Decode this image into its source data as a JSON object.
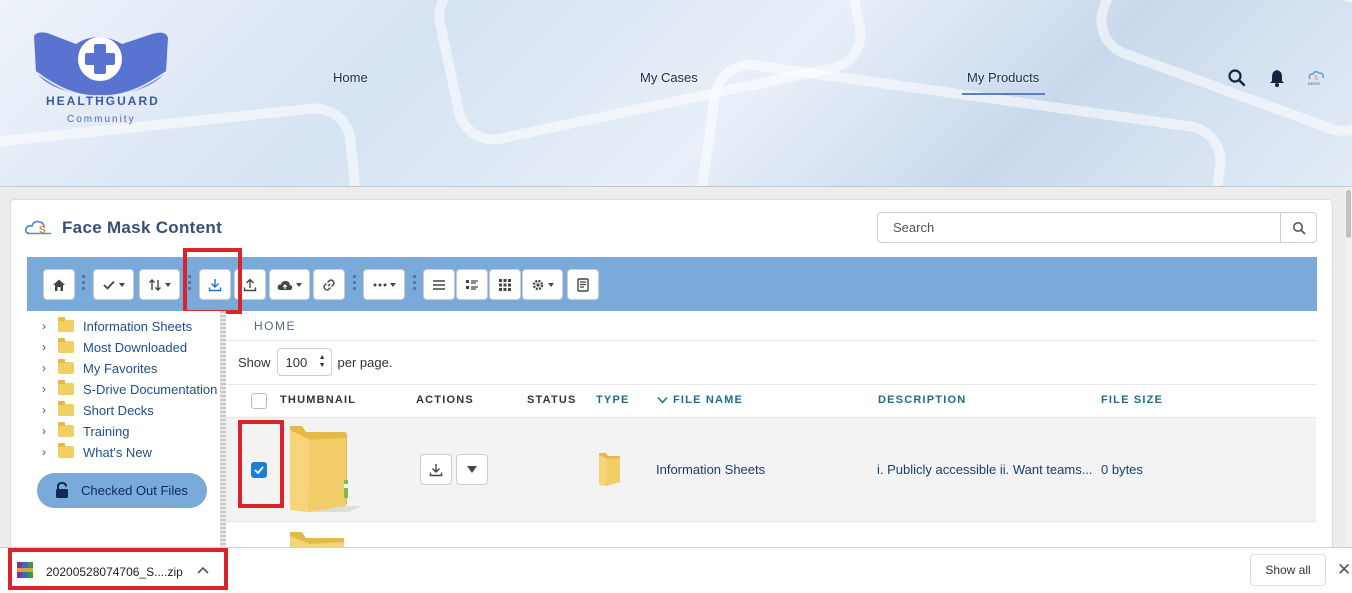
{
  "header": {
    "logo_title": "HEALTHGUARD",
    "logo_subtitle": "Community",
    "nav": [
      {
        "label": "Home"
      },
      {
        "label": "My Cases"
      },
      {
        "label": "My Products",
        "active": true
      }
    ]
  },
  "card": {
    "title": "Face Mask Content",
    "search_placeholder": "Search"
  },
  "toolbar": {
    "buttons": [
      "home-icon",
      "check-menu-icon",
      "sort-menu-icon",
      "download-icon",
      "upload-icon",
      "cloud-upload-menu-icon",
      "link-icon",
      "more-menu-icon",
      "list-view-icon",
      "detail-view-icon",
      "grid-view-icon",
      "settings-menu-icon",
      "notes-icon"
    ],
    "highlighted": "download-icon"
  },
  "tree": {
    "items": [
      {
        "label": "Information Sheets"
      },
      {
        "label": "Most Downloaded"
      },
      {
        "label": "My Favorites"
      },
      {
        "label": "S-Drive Documentation"
      },
      {
        "label": "Short Decks"
      },
      {
        "label": "Training"
      },
      {
        "label": "What's New"
      }
    ],
    "checked_out_label": "Checked Out Files"
  },
  "grid": {
    "breadcrumb": "HOME",
    "show_label": "Show",
    "per_page_value": "100",
    "per_page_suffix": "per page.",
    "columns": {
      "thumbnail": "THUMBNAIL",
      "actions": "ACTIONS",
      "status": "STATUS",
      "type": "TYPE",
      "file_name": "FILE NAME",
      "description": "DESCRIPTION",
      "file_size": "FILE SIZE"
    },
    "rows": [
      {
        "checked": true,
        "file_name": "Information Sheets",
        "description": "i. Publicly accessible ii. Want teams...",
        "file_size": "0 bytes"
      }
    ]
  },
  "download_bar": {
    "file_name": "20200528074706_S....zip",
    "show_all": "Show all"
  },
  "colors": {
    "toolbar": "#7aaad9",
    "highlight": "#d9242b",
    "link": "#1d4f91",
    "checkbox": "#1b7fd6"
  }
}
